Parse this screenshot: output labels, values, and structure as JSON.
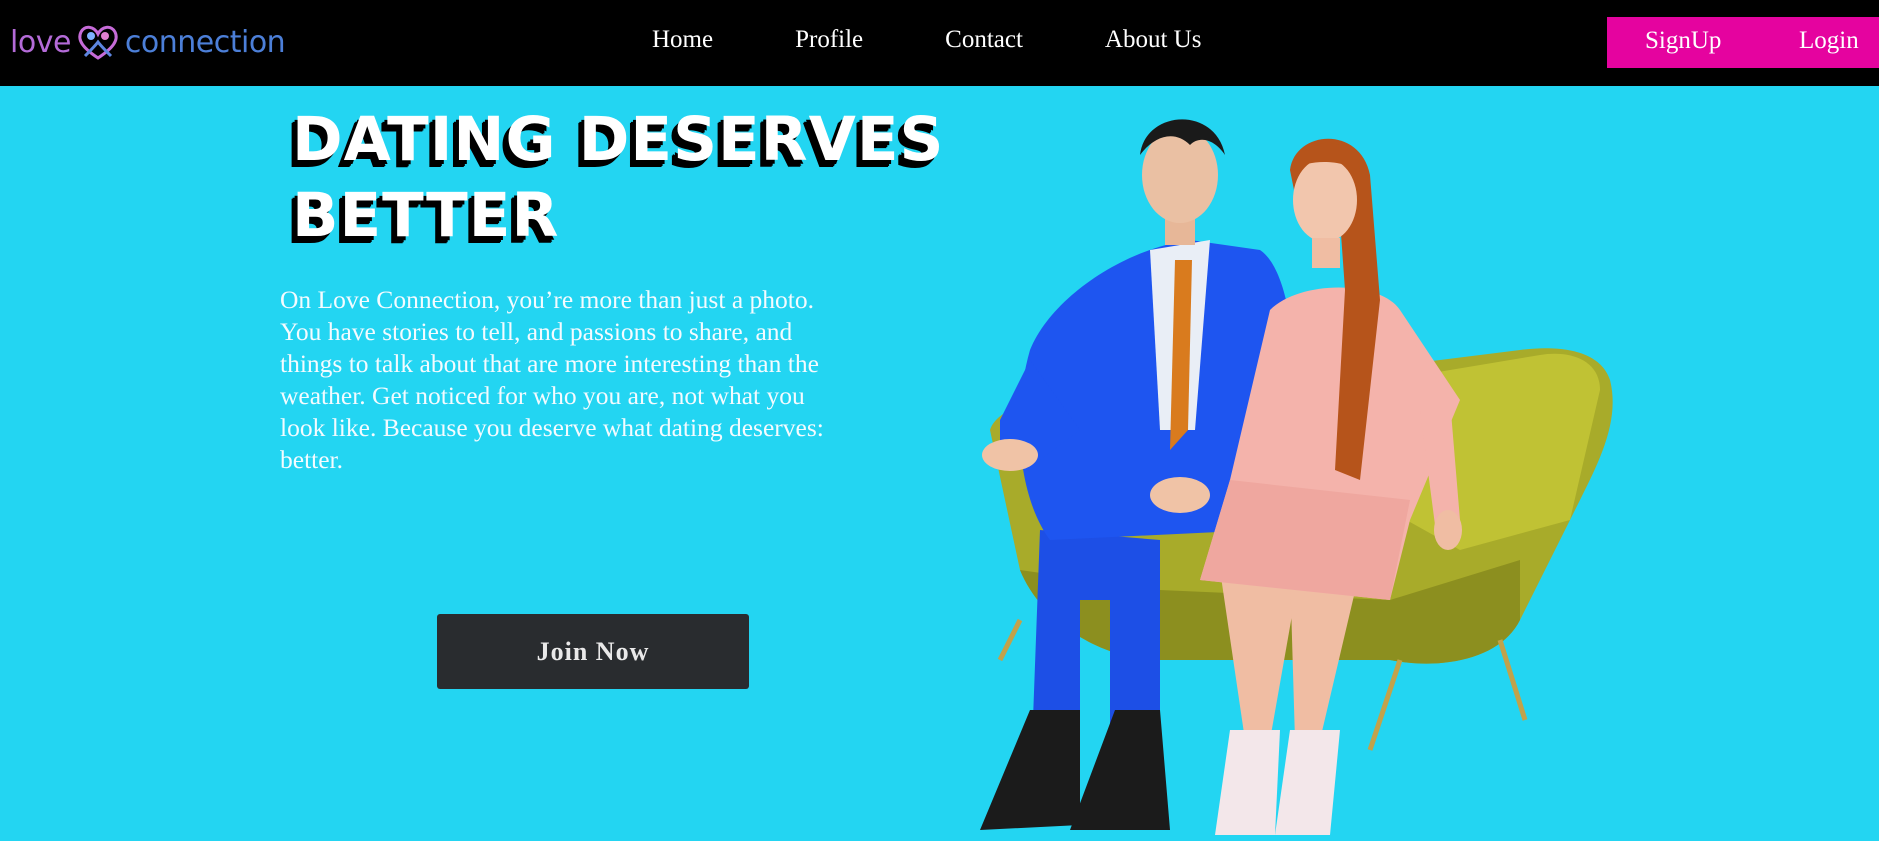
{
  "brand": {
    "love": "love",
    "connection": "connection"
  },
  "nav": {
    "links": [
      "Home",
      "Profile",
      "Contact",
      "About Us"
    ],
    "signup": "SignUp",
    "login": "Login"
  },
  "hero": {
    "headline_line1": "DATING DESERVES",
    "headline_line2": "BETTER",
    "lead": "On Love Connection, you’re more than just a photo. You have stories to tell, and passions to share, and things to talk about that are more interesting than the weather. Get noticed for who you are, not what you look like. Because you deserve what dating deserves: better.",
    "cta": "Join Now"
  },
  "colors": {
    "background": "#23d5f2",
    "nav": "#000000",
    "accent": "#e5039f",
    "button": "#292c2f"
  }
}
